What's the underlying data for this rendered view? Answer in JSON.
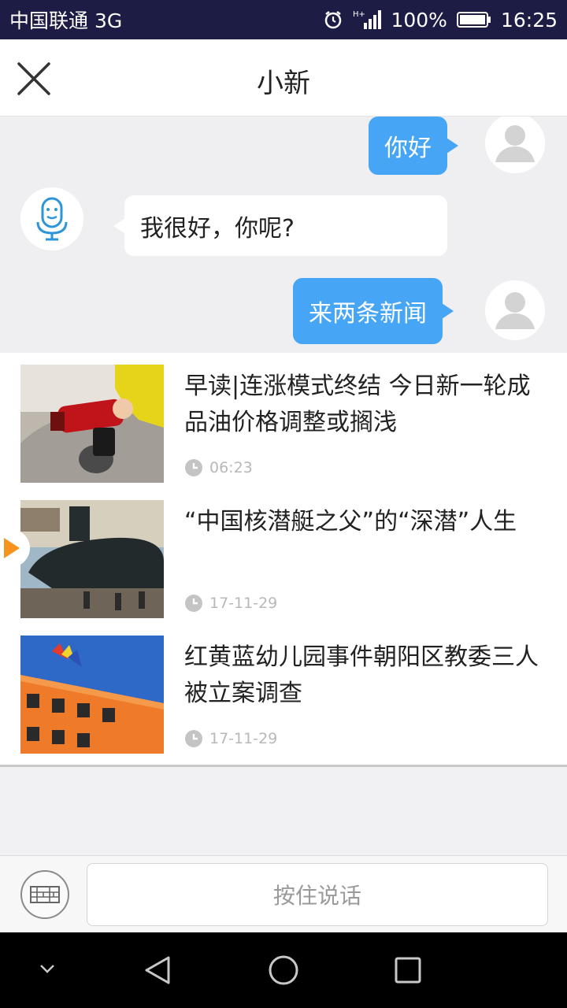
{
  "status_bar": {
    "carrier": "中国联通 3G",
    "battery": "100%",
    "time": "16:25"
  },
  "header": {
    "title": "小新",
    "close_icon": "close-icon"
  },
  "chat": {
    "messages": [
      {
        "from": "user",
        "text": "你好"
      },
      {
        "from": "bot",
        "text": "我很好，你呢?"
      },
      {
        "from": "user",
        "text": "来两条新闻"
      }
    ]
  },
  "news": {
    "items": [
      {
        "title": "早读|连涨模式终结 今日新一轮成品油价格调整或搁浅",
        "time": "06:23",
        "thumb": "fuel-pump-image"
      },
      {
        "title": "“中国核潜艇之父”的“深潜”人生",
        "time": "17-11-29",
        "thumb": "submarine-video-image"
      },
      {
        "title": "红黄蓝幼儿园事件朝阳区教委三人被立案调查",
        "time": "17-11-29",
        "thumb": "kindergarten-building-image"
      }
    ]
  },
  "input_bar": {
    "talk_label": "按住说话",
    "keyboard_icon": "keyboard-icon"
  },
  "colors": {
    "status_bar": "#1c1c44",
    "user_bubble": "#46a6f5",
    "play_accent": "#f6921e"
  }
}
